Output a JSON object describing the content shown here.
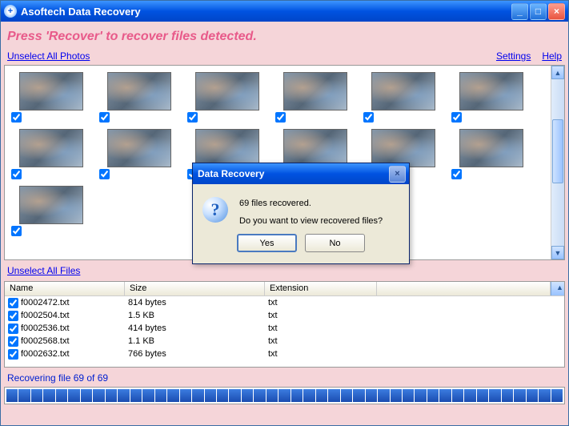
{
  "titlebar": {
    "title": "Asoftech Data Recovery"
  },
  "instruction": "Press 'Recover' to recover files detected.",
  "links": {
    "unselect_photos": "Unselect All Photos",
    "unselect_files": "Unselect All Files",
    "settings": "Settings",
    "help": "Help"
  },
  "thumbs": {
    "count_visible": 13
  },
  "files": {
    "columns": {
      "name": "Name",
      "size": "Size",
      "extension": "Extension"
    },
    "rows": [
      {
        "name": "f0002472.txt",
        "size": "814 bytes",
        "ext": "txt"
      },
      {
        "name": "f0002504.txt",
        "size": "1.5 KB",
        "ext": "txt"
      },
      {
        "name": "f0002536.txt",
        "size": "414 bytes",
        "ext": "txt"
      },
      {
        "name": "f0002568.txt",
        "size": "1.1 KB",
        "ext": "txt"
      },
      {
        "name": "f0002632.txt",
        "size": "766 bytes",
        "ext": "txt"
      }
    ]
  },
  "status": "Recovering file 69 of 69",
  "progress": {
    "segments": 45,
    "filled": 45
  },
  "dialog": {
    "title": "Data Recovery",
    "line1": "69 files recovered.",
    "line2": "Do you want to view recovered files?",
    "yes": "Yes",
    "no": "No"
  }
}
